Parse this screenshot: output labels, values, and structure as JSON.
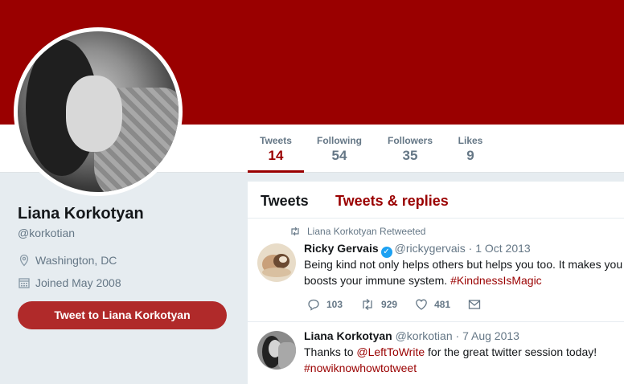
{
  "colors": {
    "brand": "#9a0000",
    "button": "#b02a2a",
    "muted": "#657786",
    "verified": "#1da1f2"
  },
  "stats": [
    {
      "label": "Tweets",
      "value": "14",
      "active": true
    },
    {
      "label": "Following",
      "value": "54"
    },
    {
      "label": "Followers",
      "value": "35"
    },
    {
      "label": "Likes",
      "value": "9"
    }
  ],
  "profile": {
    "name": "Liana Korkotyan",
    "handle": "@korkotian",
    "location": "Washington, DC",
    "joined": "Joined May 2008",
    "location_icon": "location-pin-icon",
    "joined_icon": "calendar-icon",
    "tweet_to_label": "Tweet to Liana Korkotyan"
  },
  "tabs": [
    {
      "label": "Tweets",
      "active": true
    },
    {
      "label": "Tweets & replies"
    }
  ],
  "tweets": [
    {
      "retweeted_by": "Liana Korkotyan Retweeted",
      "name": "Ricky Gervais",
      "verified": true,
      "handle": "@rickygervais",
      "sep": "·",
      "date": "1 Oct 2013",
      "text_line1": "Being kind not only helps others but helps you too. It makes you",
      "text_line2_pre": "boosts your immune system. ",
      "hashtag": "#KindnessIsMagic",
      "replies": "103",
      "retweets": "929",
      "likes": "481"
    },
    {
      "name": "Liana Korkotyan",
      "handle": "@korkotian",
      "sep": "·",
      "date": "7 Aug 2013",
      "text_pre": "Thanks to ",
      "mention": "@LeftToWrite",
      "text_post": " for the great twitter session today!",
      "hashtag": "#nowiknowhowtotweet"
    }
  ]
}
